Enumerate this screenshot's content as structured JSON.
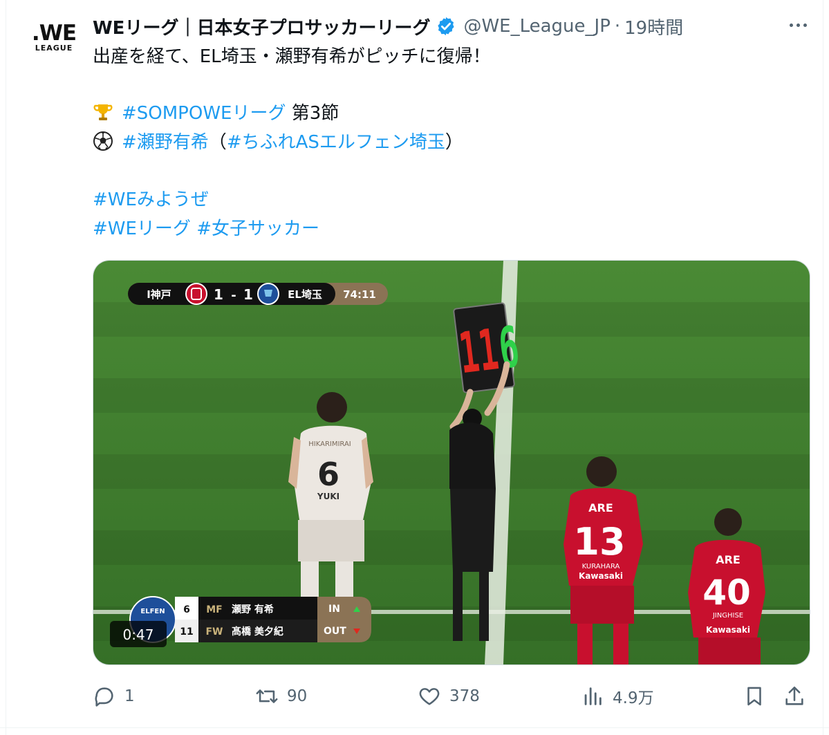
{
  "tweet": {
    "avatar_logo_line1": ".WE",
    "avatar_logo_line2": "LEAGUE",
    "display_name": "WEリーグ｜日本女子プロサッカーリーグ",
    "handle": "@WE_League_JP",
    "separator": "·",
    "time": "19時間",
    "text_line1": "出産を経て、EL埼玉・瀬野有希がピッチに復帰！",
    "line2_hashtag": "#SOMPOWEリーグ",
    "line2_suffix": " 第3節",
    "line3_hashtag1": "#瀬野有希",
    "line3_open": "（",
    "line3_hashtag2": "#ちふれASエルフェン埼玉",
    "line3_close": "）",
    "hashtag_we_miyouze": "#WEみようぜ",
    "hashtag_we_league": "#WEリーグ",
    "hashtag_joshi_soccer": "#女子サッカー",
    "icons": {
      "line2": "trophy-icon",
      "line3": "soccer-ball-icon",
      "verified": "verified-badge-icon",
      "more": "more-icon"
    }
  },
  "video": {
    "scoreboard": {
      "home_team": "I神戸",
      "home_score": "1",
      "score_sep": "-",
      "away_score": "1",
      "away_team": "EL埼玉",
      "match_clock": "74:11"
    },
    "board_numbers": {
      "red": "11",
      "green": "6"
    },
    "substitution": {
      "team_logo_text": "ELFEN",
      "in_number": "6",
      "in_position": "MF",
      "in_name": "瀬野 有希",
      "in_label": "IN",
      "out_number": "11",
      "out_position": "FW",
      "out_name": "髙橋 美夕紀",
      "out_label": "OUT"
    },
    "players": {
      "player_6_name": "YUKI",
      "player_6_number": "6",
      "player_6_sponsor": "HIKARIMIRAI",
      "player_13_top": "ARE",
      "player_13_number": "13",
      "player_13_name": "KURAHARA",
      "player_13_sponsor": "Kawasaki",
      "player_40_top": "ARE",
      "player_40_number": "40",
      "player_40_name": "JINGHISE",
      "player_40_sponsor": "Kawasaki"
    },
    "elapsed": "0:47",
    "colors": {
      "pitch": "#3d7a2c",
      "red_kit": "#c8102e",
      "gold_bar": "#8b7355",
      "scoreboard_bg": "#111111"
    }
  },
  "actions": {
    "reply_count": "1",
    "retweet_count": "90",
    "like_count": "378",
    "view_count": "4.9万",
    "icons": [
      "reply-icon",
      "retweet-icon",
      "like-icon",
      "views-icon",
      "bookmark-icon",
      "share-icon"
    ]
  }
}
